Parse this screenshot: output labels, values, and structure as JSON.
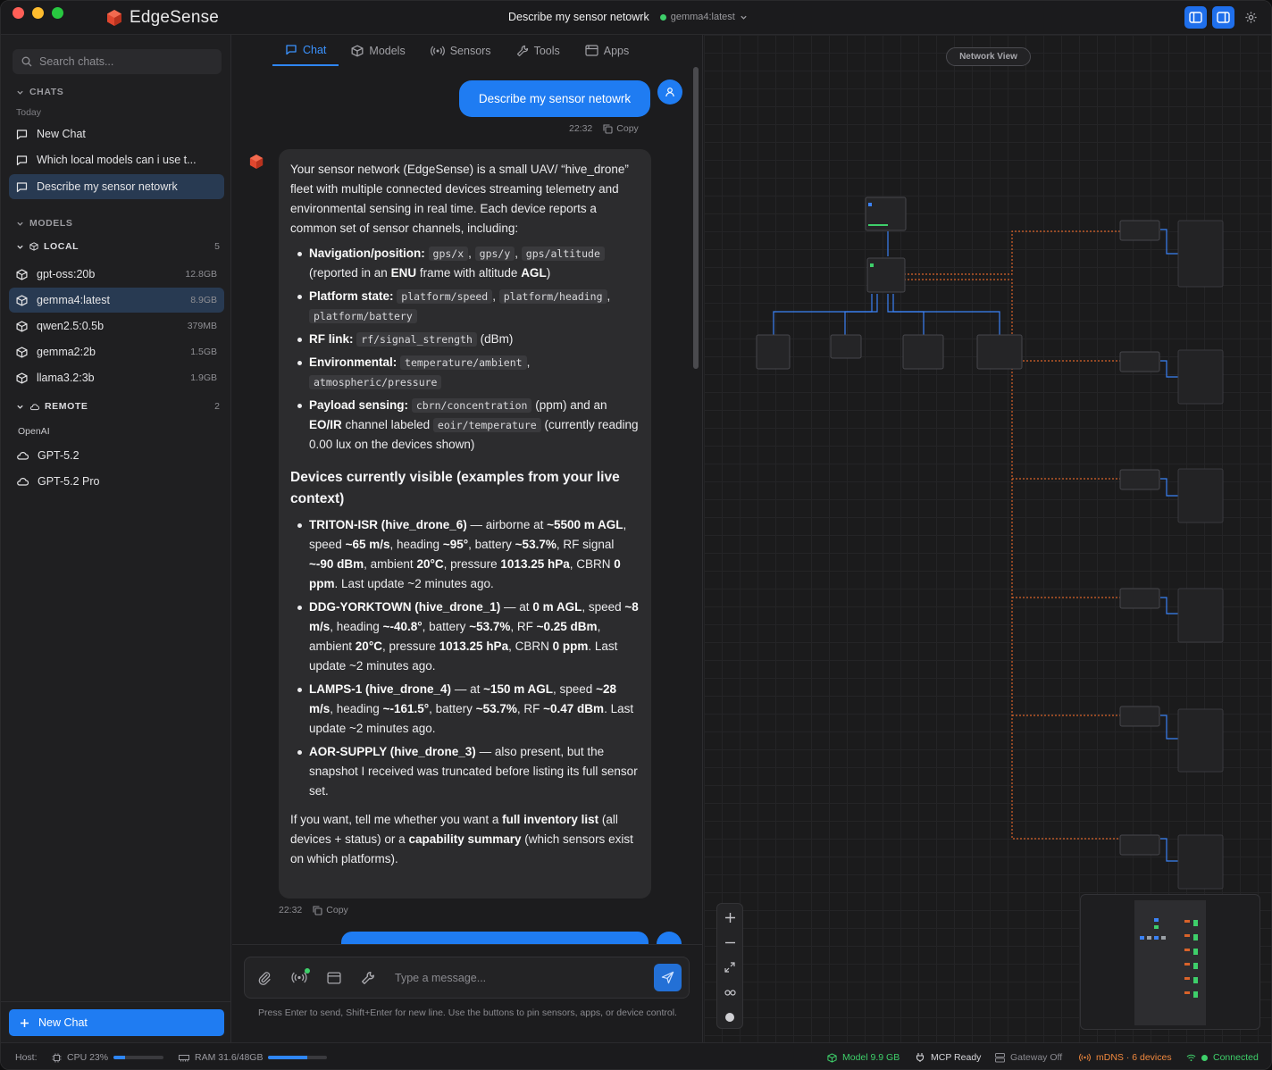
{
  "app": {
    "name": "EdgeSense",
    "window_title": "Describe my sensor netowrk",
    "current_model": "gemma4:latest"
  },
  "sidebar": {
    "search_placeholder": "Search chats...",
    "chats_header": "CHATS",
    "today_label": "Today",
    "chats": [
      {
        "label": "New Chat"
      },
      {
        "label": "Which local models can i use t..."
      },
      {
        "label": "Describe my sensor netowrk"
      }
    ],
    "models_header": "MODELS",
    "local_header": "LOCAL",
    "local_count": "5",
    "local_models": [
      {
        "name": "gpt-oss:20b",
        "size": "12.8GB"
      },
      {
        "name": "gemma4:latest",
        "size": "8.9GB"
      },
      {
        "name": "qwen2.5:0.5b",
        "size": "379MB"
      },
      {
        "name": "gemma2:2b",
        "size": "1.5GB"
      },
      {
        "name": "llama3.2:3b",
        "size": "1.9GB"
      }
    ],
    "remote_header": "REMOTE",
    "remote_count": "2",
    "provider": "OpenAI",
    "remote_models": [
      {
        "name": "GPT-5.2"
      },
      {
        "name": "GPT-5.2 Pro"
      }
    ],
    "new_chat_label": "New Chat"
  },
  "tabs": [
    {
      "label": "Chat"
    },
    {
      "label": "Models"
    },
    {
      "label": "Sensors"
    },
    {
      "label": "Tools"
    },
    {
      "label": "Apps"
    }
  ],
  "conversation": {
    "user_message": "Describe my sensor netowrk",
    "user_time": "22:32",
    "copy_label": "Copy",
    "bot_time": "22:32",
    "intro": "Your sensor network (EdgeSense) is a small UAV/ “hive_drone” fleet with multiple connected devices streaming telemetry and environmental sensing in real time. Each device reports a common set of sensor channels, including:",
    "nav_label": "Navigation/position:",
    "nav_codes": [
      "gps/x",
      "gps/y",
      "gps/altitude"
    ],
    "nav_tail_1": "(reported in an",
    "nav_enu": "ENU",
    "nav_tail_2": "frame with altitude",
    "nav_agl": "AGL",
    "nav_tail_3": ")",
    "platform_label": "Platform state:",
    "platform_codes": [
      "platform/speed",
      "platform/heading",
      "platform/battery"
    ],
    "rf_label": "RF link:",
    "rf_code": "rf/signal_strength",
    "rf_tail": "(dBm)",
    "env_label": "Environmental:",
    "env_codes": [
      "temperature/ambient",
      "atmospheric/pressure"
    ],
    "payload_label": "Payload sensing:",
    "payload_code": "cbrn/concentration",
    "payload_tail_1": "(ppm) and an",
    "payload_eoir": "EO/IR",
    "payload_tail_2": "channel labeled",
    "payload_code2": "eoir/temperature",
    "payload_tail_3": "(currently reading 0.00 lux on the devices shown)",
    "devices_heading": "Devices currently visible (examples from your live context)",
    "d1_name": "TRITON-ISR (hive_drone_6)",
    "d1_a": "— airborne at",
    "d1_alt": "~5500 m AGL",
    "d1_b": ", speed",
    "d1_speed": "~65 m/s",
    "d1_c": ", heading",
    "d1_heading": "~95°",
    "d1_d": ", battery",
    "d1_batt": "~53.7%",
    "d1_e": ", RF signal",
    "d1_rf": "~-90 dBm",
    "d1_f": ", ambient",
    "d1_temp": "20°C",
    "d1_g": ", pressure",
    "d1_press": "1013.25 hPa",
    "d1_h": ", CBRN",
    "d1_cbrn": "0 ppm",
    "d1_i": ". Last update ~2 minutes ago.",
    "d2_name": "DDG-YORKTOWN (hive_drone_1)",
    "d2_a": "— at",
    "d2_alt": "0 m AGL",
    "d2_b": ", speed",
    "d2_speed": "~8 m/s",
    "d2_c": ", heading",
    "d2_heading": "~-40.8°",
    "d2_d": ", battery",
    "d2_batt": "~53.7%",
    "d2_e": ", RF",
    "d2_rf": "~0.25 dBm",
    "d2_f": ", ambient",
    "d2_temp": "20°C",
    "d2_g": ", pressure",
    "d2_press": "1013.25 hPa",
    "d2_h": ", CBRN",
    "d2_cbrn": "0 ppm",
    "d2_i": ". Last update ~2 minutes ago.",
    "d3_name": "LAMPS-1 (hive_drone_4)",
    "d3_a": "— at",
    "d3_alt": "~150 m AGL",
    "d3_b": ", speed",
    "d3_speed": "~28 m/s",
    "d3_c": ", heading",
    "d3_heading": "~-161.5°",
    "d3_d": ", battery",
    "d3_batt": "~53.7%",
    "d3_e": ", RF",
    "d3_rf": "~0.47 dBm",
    "d3_f": ". Last update ~2 minutes ago.",
    "d4_name": "AOR-SUPPLY (hive_drone_3)",
    "d4_a": "— also present, but the snapshot I received was truncated before listing its full sensor set.",
    "outro_1": "If you want, tell me whether you want a",
    "outro_b1": "full inventory list",
    "outro_2": "(all devices + status) or a",
    "outro_b2": "capability summary",
    "outro_3": "(which sensors exist on which platforms)."
  },
  "composer": {
    "placeholder": "Type a message...",
    "hint": "Press Enter to send, Shift+Enter for new line. Use the buttons to pin sensors, apps, or device control."
  },
  "network": {
    "view_label": "Network View"
  },
  "status": {
    "host_label": "Host:",
    "cpu_label": "CPU 23%",
    "cpu_fraction": 0.23,
    "ram_label": "RAM 31.6/48GB",
    "ram_fraction": 0.658,
    "model_label": "Model 9.9 GB",
    "mcp_label": "MCP Ready",
    "gateway_label": "Gateway Off",
    "mdns_label": "mDNS · 6 devices",
    "connected_label": "Connected"
  },
  "colors": {
    "accent": "#1f7cf2",
    "status_green": "#3ecf6a",
    "mdns_orange": "#f0883e",
    "link_orange": "#d9632a",
    "link_blue": "#3b82f6"
  }
}
